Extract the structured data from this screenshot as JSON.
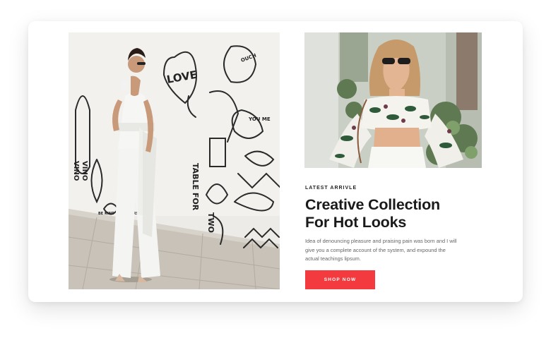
{
  "promo": {
    "eyebrow": "LATEST ARRIVLE",
    "headline_line1": "Creative Collection",
    "headline_line2": "For Hot Looks",
    "body": "Idea of denouncing pleasure and praising pain was born and I will give you a complete account of the system, and expound the actual teachings lipsum.",
    "button_label": "SHOP NOW"
  },
  "mural_text": {
    "love": "LOVE",
    "ouch": "OUCH",
    "you_me": "YOU ME",
    "table_for": "TABLE FOR",
    "two": "TWO",
    "vino": "VINO",
    "vino2": "VINO",
    "be_kind": "BE KIND TO OTHERS"
  },
  "colors": {
    "accent": "#f23a3f",
    "headline": "#1a1a1a",
    "body": "#666666"
  },
  "images": {
    "left": "woman-in-white-jumpsuit-mural-photo",
    "right": "woman-in-floral-top-sunglasses-photo"
  }
}
